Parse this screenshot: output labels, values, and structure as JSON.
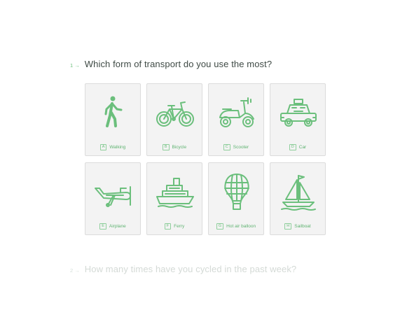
{
  "question1": {
    "number": "1 →",
    "text": "Which form of transport do you use the most?"
  },
  "question2": {
    "number": "2 →",
    "text": "How many times have you cycled in the past week?"
  },
  "accent_color": "#6bbf7c",
  "options": [
    {
      "key": "A",
      "label": "Walking",
      "icon": "walking-person-icon"
    },
    {
      "key": "B",
      "label": "Bicycle",
      "icon": "bicycle-icon"
    },
    {
      "key": "C",
      "label": "Scooter",
      "icon": "scooter-icon"
    },
    {
      "key": "D",
      "label": "Car",
      "icon": "car-icon"
    },
    {
      "key": "E",
      "label": "Airplane",
      "icon": "airplane-icon"
    },
    {
      "key": "F",
      "label": "Ferry",
      "icon": "ferry-icon"
    },
    {
      "key": "G",
      "label": "Hot air balloon",
      "icon": "hot-air-balloon-icon"
    },
    {
      "key": "H",
      "label": "Sailboat",
      "icon": "sailboat-icon"
    }
  ]
}
